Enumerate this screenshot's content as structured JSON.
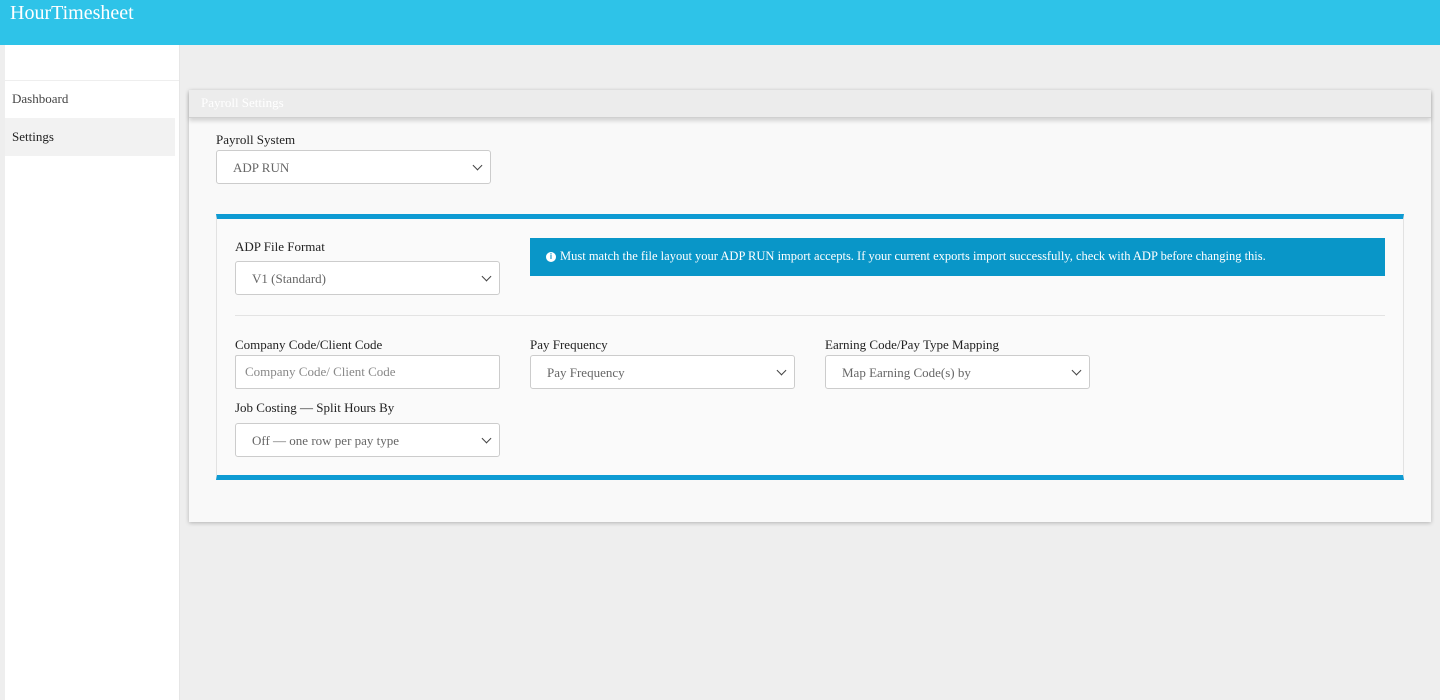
{
  "app": {
    "title": "HourTimesheet"
  },
  "sidebar": {
    "items": [
      {
        "label": "Dashboard"
      },
      {
        "label": "Settings"
      }
    ]
  },
  "panel": {
    "heading": "Payroll Settings"
  },
  "payroll_system": {
    "label": "Payroll System",
    "value": "ADP RUN"
  },
  "adp_file_format": {
    "label": "ADP File Format",
    "value": "V1 (Standard)"
  },
  "alert": {
    "text": "Must match the file layout your ADP RUN import accepts. If your current exports import successfully, check with ADP before changing this.",
    "icon": "info-icon",
    "color": "#0996c8"
  },
  "company_code": {
    "label": "Company Code/Client Code",
    "placeholder": "Company Code/ Client Code",
    "value": ""
  },
  "pay_frequency": {
    "label": "Pay Frequency",
    "value": "Pay Frequency"
  },
  "earning_code": {
    "label": "Earning Code/Pay Type Mapping",
    "value": "Map Earning Code(s) by"
  },
  "job_costing": {
    "label": "Job Costing — Split Hours By",
    "value": "Off — one row per pay type"
  },
  "colors": {
    "topbar": "#2ec3e8",
    "accent": "#0e9bd3"
  }
}
